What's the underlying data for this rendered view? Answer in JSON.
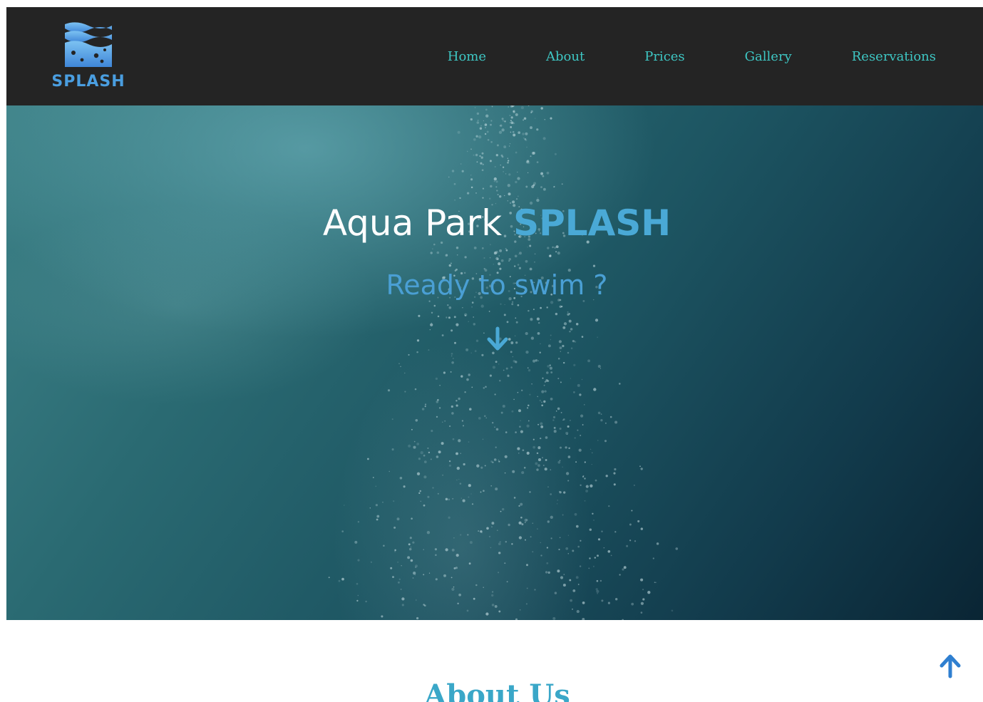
{
  "header": {
    "logo_text": "SPLASH",
    "logo_icon": "waves-logo-icon",
    "nav": [
      {
        "label": "Home"
      },
      {
        "label": "About"
      },
      {
        "label": "Prices"
      },
      {
        "label": "Gallery"
      },
      {
        "label": "Reservations"
      }
    ]
  },
  "hero": {
    "title_prefix": "Aqua Park ",
    "title_accent": "SPLASH",
    "subtitle": "Ready to swim ?",
    "scroll_icon": "arrow-down-icon"
  },
  "about": {
    "title": "About Us"
  },
  "back_to_top_icon": "arrow-up-icon",
  "colors": {
    "navbar_bg": "#242424",
    "nav_link": "#3ec7c4",
    "brand_blue": "#4a9ee0",
    "hero_accent": "#4aa9d6",
    "section_title": "#3aa7c8"
  }
}
